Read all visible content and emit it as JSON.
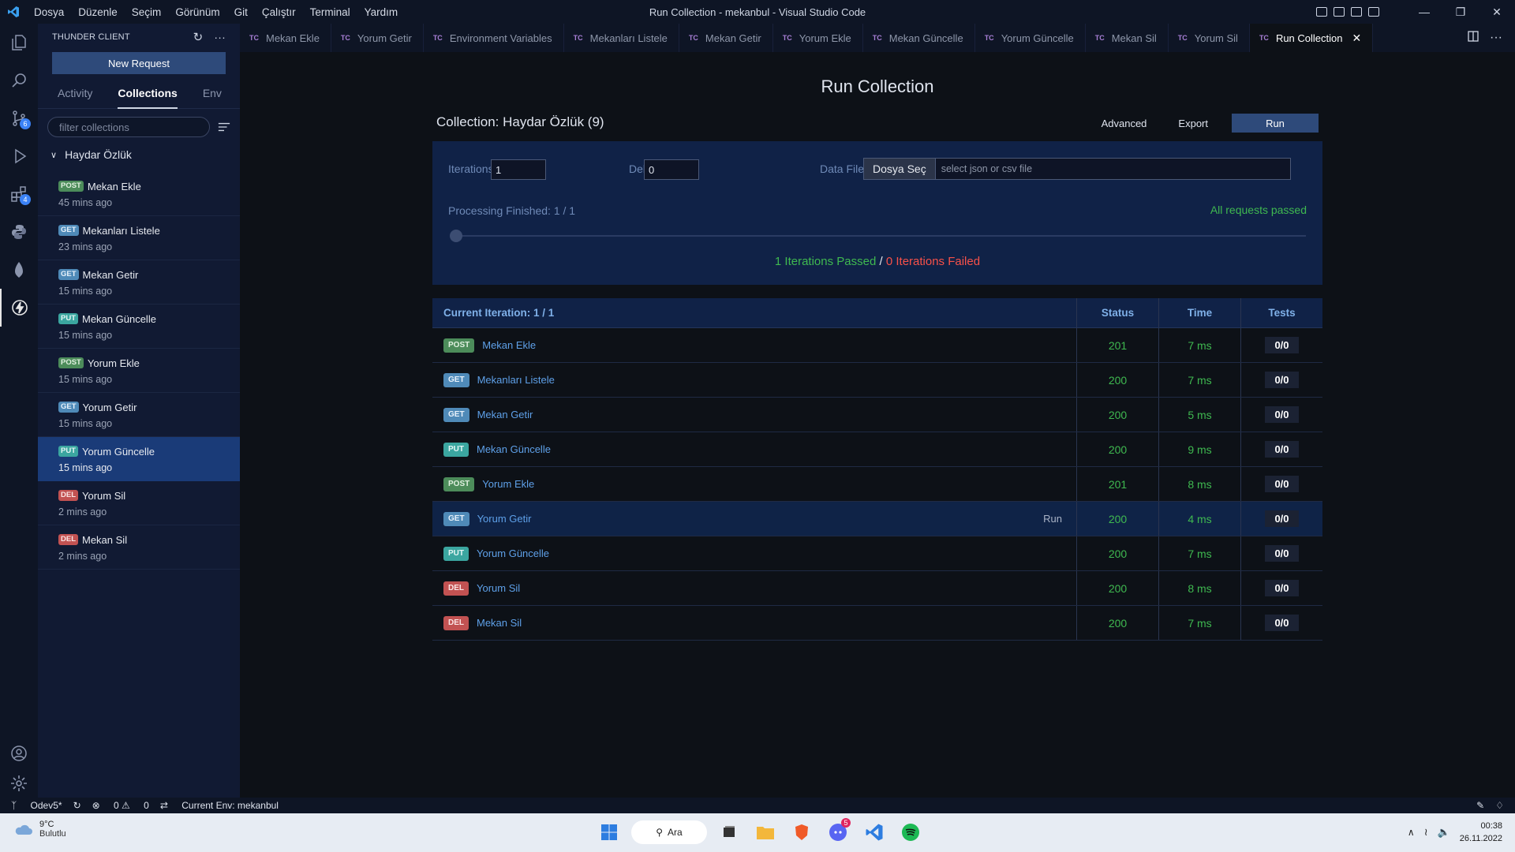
{
  "window": {
    "title": "Run Collection - mekanbul - Visual Studio Code",
    "menu": [
      "Dosya",
      "Düzenle",
      "Seçim",
      "Görünüm",
      "Git",
      "Çalıştır",
      "Terminal",
      "Yardım"
    ]
  },
  "activity_bar": {
    "badges": {
      "source_control": "6",
      "extensions": "4"
    }
  },
  "sidebar": {
    "header": "THUNDER CLIENT",
    "new_request": "New Request",
    "tabs": [
      "Activity",
      "Collections",
      "Env"
    ],
    "active_tab": "Collections",
    "filter_placeholder": "filter collections",
    "folder": "Haydar Özlük",
    "requests": [
      {
        "method": "POST",
        "name": "Mekan Ekle",
        "time": "45 mins ago"
      },
      {
        "method": "GET",
        "name": "Mekanları Listele",
        "time": "23 mins ago"
      },
      {
        "method": "GET",
        "name": "Mekan Getir",
        "time": "15 mins ago"
      },
      {
        "method": "PUT",
        "name": "Mekan Güncelle",
        "time": "15 mins ago"
      },
      {
        "method": "POST",
        "name": "Yorum Ekle",
        "time": "15 mins ago"
      },
      {
        "method": "GET",
        "name": "Yorum Getir",
        "time": "15 mins ago"
      },
      {
        "method": "PUT",
        "name": "Yorum Güncelle",
        "time": "15 mins ago",
        "selected": true
      },
      {
        "method": "DEL",
        "name": "Yorum Sil",
        "time": "2 mins ago"
      },
      {
        "method": "DEL",
        "name": "Mekan Sil",
        "time": "2 mins ago"
      }
    ]
  },
  "tabs": [
    {
      "icon": "TC",
      "label": "Mekan Ekle"
    },
    {
      "icon": "TC",
      "label": "Yorum Getir"
    },
    {
      "icon": "TC",
      "label": "Environment Variables"
    },
    {
      "icon": "TC",
      "label": "Mekanları Listele"
    },
    {
      "icon": "TC",
      "label": "Mekan Getir"
    },
    {
      "icon": "TC",
      "label": "Yorum Ekle"
    },
    {
      "icon": "TC",
      "label": "Mekan Güncelle"
    },
    {
      "icon": "TC",
      "label": "Yorum Güncelle"
    },
    {
      "icon": "TC",
      "label": "Mekan Sil"
    },
    {
      "icon": "TC",
      "label": "Yorum Sil"
    },
    {
      "icon": "TC",
      "label": "Run Collection",
      "active": true
    }
  ],
  "run": {
    "title": "Run Collection",
    "collection": "Collection: Haydar Özlük (9)",
    "advanced": "Advanced",
    "export": "Export",
    "run_button": "Run",
    "iterations_label": "Iterations:",
    "iterations_value": "1",
    "delay_label": "Delay (ms):",
    "delay_value": "0",
    "datafile_label": "Data File:",
    "datafile_button": "Dosya Seç",
    "datafile_placeholder": "select json or csv file",
    "processing": "Processing Finished: 1 / 1",
    "all_passed": "All requests passed",
    "progress": 1.0,
    "iter_passed": "1 Iterations Passed",
    "iter_sep": " / ",
    "iter_failed": "0 Iterations Failed"
  },
  "results": {
    "header": {
      "current": "Current Iteration: 1 / 1",
      "status": "Status",
      "time": "Time",
      "tests": "Tests"
    },
    "run_link": "Run",
    "rows": [
      {
        "method": "POST",
        "name": "Mekan Ekle",
        "status": "201",
        "time": "7 ms",
        "tests": "0/0"
      },
      {
        "method": "GET",
        "name": "Mekanları Listele",
        "status": "200",
        "time": "7 ms",
        "tests": "0/0"
      },
      {
        "method": "GET",
        "name": "Mekan Getir",
        "status": "200",
        "time": "5 ms",
        "tests": "0/0"
      },
      {
        "method": "PUT",
        "name": "Mekan Güncelle",
        "status": "200",
        "time": "9 ms",
        "tests": "0/0"
      },
      {
        "method": "POST",
        "name": "Yorum Ekle",
        "status": "201",
        "time": "8 ms",
        "tests": "0/0"
      },
      {
        "method": "GET",
        "name": "Yorum Getir",
        "status": "200",
        "time": "4 ms",
        "tests": "0/0",
        "hover": true
      },
      {
        "method": "PUT",
        "name": "Yorum Güncelle",
        "status": "200",
        "time": "7 ms",
        "tests": "0/0"
      },
      {
        "method": "DEL",
        "name": "Yorum Sil",
        "status": "200",
        "time": "8 ms",
        "tests": "0/0"
      },
      {
        "method": "DEL",
        "name": "Mekan Sil",
        "status": "200",
        "time": "7 ms",
        "tests": "0/0"
      }
    ]
  },
  "statusbar": {
    "branch": "Odev5*",
    "errors": "0",
    "warnings": "0",
    "env": "Current Env: mekanbul"
  },
  "taskbar": {
    "temp": "9°C",
    "weather": "Bulutlu",
    "search": "Ara",
    "discord_badge": "5",
    "time": "00:38",
    "date": "26.11.2022"
  },
  "colors": {
    "accent": "#2e4a7a",
    "success": "#3fb950",
    "fail": "#f85149"
  }
}
